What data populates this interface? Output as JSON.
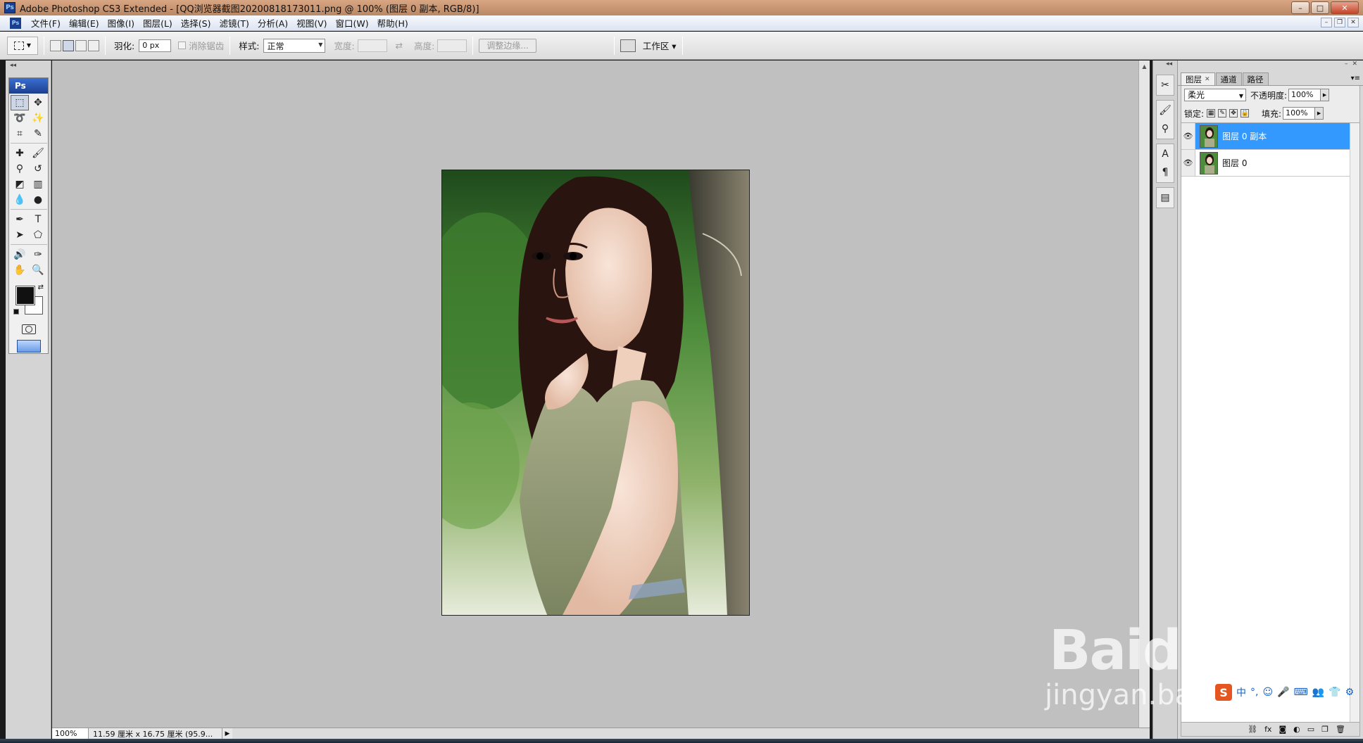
{
  "titlebar": {
    "app_icon": "Ps",
    "title": "Adobe Photoshop CS3 Extended - [QQ浏览器截图20200818173011.png @ 100% (图层 0 副本, RGB/8)]",
    "minimize": "–",
    "maximize": "□",
    "close": "✕"
  },
  "menubar": {
    "doc_icon": "Ps",
    "items": [
      "文件(F)",
      "编辑(E)",
      "图像(I)",
      "图层(L)",
      "选择(S)",
      "滤镜(T)",
      "分析(A)",
      "视图(V)",
      "窗口(W)",
      "帮助(H)"
    ]
  },
  "options": {
    "feather_label": "羽化:",
    "feather_value": "0 px",
    "antialias_label": "消除锯齿",
    "style_label": "样式:",
    "style_value": "正常",
    "width_label": "宽度:",
    "swap_label": "⇄",
    "height_label": "高度:",
    "refine_button": "调整边缘...",
    "workspace_label": "工作区 ▾"
  },
  "toolbox": {
    "badge": "Ps"
  },
  "statusbar": {
    "zoom": "100%",
    "doc_info": "11.59 厘米 x 16.75 厘米 (95.9..."
  },
  "layers_panel": {
    "tabs": [
      "图层",
      "通道",
      "路径"
    ],
    "blend_mode": "柔光",
    "opacity_label": "不透明度:",
    "opacity_value": "100%",
    "lock_label": "锁定:",
    "fill_label": "填充:",
    "fill_value": "100%",
    "layers": [
      {
        "name": "图层 0 副本",
        "selected": true
      },
      {
        "name": "图层 0",
        "selected": false
      }
    ],
    "footer_icons": [
      "link-icon",
      "fx-icon",
      "mask-icon",
      "adjustment-icon",
      "group-icon",
      "new-layer-icon",
      "trash-icon"
    ]
  },
  "watermark": {
    "brand": "Baidu经验",
    "url": "jingyan.baidu.com"
  },
  "ime": {
    "logo": "S",
    "items": [
      "中",
      "°,",
      "☺",
      "🎤",
      "⌨",
      "👥",
      "👕",
      "⚙"
    ]
  },
  "colors": {
    "selected_layer": "#3399ff",
    "canvas_bg": "#c0c0c0"
  }
}
